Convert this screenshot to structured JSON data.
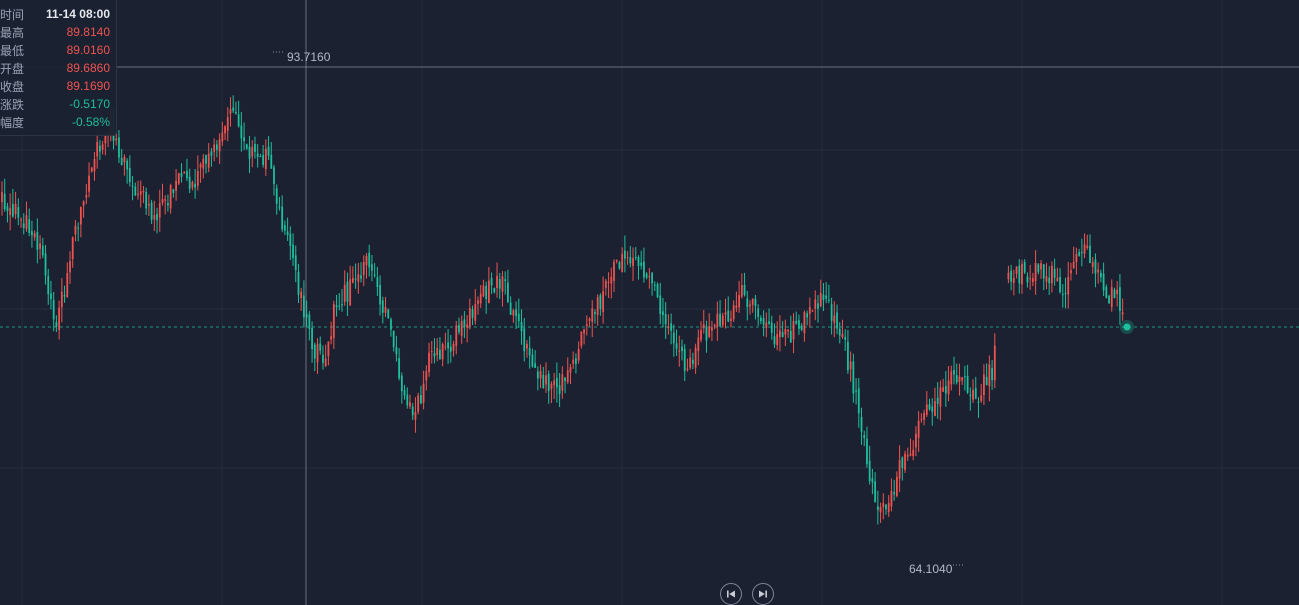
{
  "tooltip": {
    "rows": [
      {
        "label": "时间",
        "value": "11-14 08:00"
      },
      {
        "label": "最高",
        "value": "89.8140"
      },
      {
        "label": "最低",
        "value": "89.0160"
      },
      {
        "label": "开盘",
        "value": "89.6860"
      },
      {
        "label": "收盘",
        "value": "89.1690"
      },
      {
        "label": "涨跌",
        "value": "-0.5170"
      },
      {
        "label": "幅度",
        "value": "-0.58%"
      }
    ]
  },
  "annotations": {
    "high_label": "93.7160",
    "low_label": "64.1040"
  },
  "nav": {
    "prev_icon": "skip-back-icon",
    "next_icon": "skip-forward-icon"
  },
  "colors": {
    "background": "#1b2130",
    "up": "#ef5350",
    "down": "#1dbf9c",
    "grid": "#263040",
    "crosshair": "#8a909c",
    "last_price_line": "#1dbf9c"
  },
  "chart_data": {
    "type": "candlestick",
    "y_range": [
      64.104,
      93.716
    ],
    "max": 93.716,
    "min": 64.104,
    "hovered": {
      "time": "11-14 08:00",
      "high": 89.814,
      "low": 89.016,
      "open": 89.686,
      "close": 89.169
    },
    "trend_anchors": [
      [
        0,
        85.2
      ],
      [
        7,
        84.5
      ],
      [
        14,
        82.2
      ],
      [
        20,
        78.0
      ],
      [
        28,
        84.0
      ],
      [
        34,
        87.6
      ],
      [
        40,
        89.6
      ],
      [
        46,
        86.6
      ],
      [
        52,
        85.2
      ],
      [
        56,
        84.0
      ],
      [
        64,
        86.3
      ],
      [
        72,
        86.4
      ],
      [
        80,
        88.5
      ],
      [
        84,
        91.0
      ],
      [
        90,
        88.0
      ],
      [
        98,
        87.5
      ],
      [
        106,
        82.0
      ],
      [
        114,
        77.0
      ],
      [
        118,
        75.6
      ],
      [
        122,
        78.6
      ],
      [
        128,
        80.2
      ],
      [
        134,
        81.5
      ],
      [
        140,
        79.2
      ],
      [
        146,
        75.0
      ],
      [
        152,
        72.6
      ],
      [
        158,
        76.6
      ],
      [
        164,
        76.2
      ],
      [
        170,
        78.4
      ],
      [
        178,
        80.0
      ],
      [
        184,
        80.3
      ],
      [
        190,
        77.8
      ],
      [
        196,
        75.4
      ],
      [
        202,
        74.0
      ],
      [
        208,
        75.0
      ],
      [
        214,
        77.4
      ],
      [
        222,
        80.2
      ],
      [
        228,
        81.8
      ],
      [
        234,
        81.2
      ],
      [
        240,
        80.0
      ],
      [
        246,
        77.6
      ],
      [
        252,
        75.0
      ],
      [
        258,
        77.6
      ],
      [
        266,
        78.2
      ],
      [
        272,
        79.8
      ],
      [
        278,
        78.6
      ],
      [
        284,
        76.8
      ],
      [
        290,
        77.6
      ],
      [
        296,
        78.5
      ],
      [
        302,
        79.5
      ],
      [
        308,
        77.8
      ],
      [
        314,
        74.0
      ],
      [
        318,
        70.0
      ],
      [
        322,
        67.2
      ],
      [
        326,
        67.8
      ],
      [
        330,
        69.6
      ],
      [
        336,
        71.5
      ],
      [
        342,
        73.5
      ],
      [
        347,
        74.5
      ],
      [
        352,
        75.0
      ],
      [
        358,
        73.6
      ],
      [
        364,
        75.4
      ],
      [
        370,
        80.4
      ],
      [
        374,
        81.0
      ],
      [
        380,
        80.9
      ],
      [
        386,
        81.0
      ],
      [
        391,
        79.6
      ],
      [
        394,
        81.6
      ],
      [
        398,
        82.2
      ],
      [
        402,
        81.3
      ],
      [
        405,
        80.0
      ],
      [
        410,
        79.4
      ],
      [
        412,
        78.6
      ]
    ],
    "gaps": [
      [
        366,
        369
      ]
    ]
  }
}
